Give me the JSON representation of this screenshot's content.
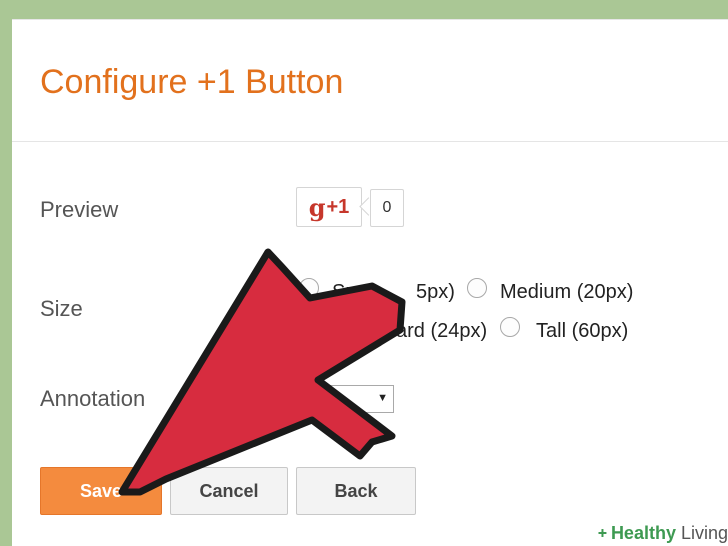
{
  "page": {
    "title": "Configure +1 Button"
  },
  "preview": {
    "label": "Preview",
    "button_g": "g",
    "button_plus": "+1",
    "count": "0"
  },
  "size": {
    "label": "Size",
    "options": [
      {
        "label": "Small (15px)",
        "visible_text": "Sm",
        "visible_text_2": "5px)",
        "selected": false
      },
      {
        "label": "Medium (20px)",
        "selected": false
      },
      {
        "label": "Standard (24px)",
        "visible_text": "ard (24px)",
        "selected": true
      },
      {
        "label": "Tall (60px)",
        "selected": false
      }
    ]
  },
  "annotation": {
    "label": "Annotation",
    "selected_visible": "ble"
  },
  "buttons": {
    "save": "Save",
    "cancel": "Cancel",
    "back": "Back"
  },
  "watermark": {
    "brand_bold": "Healthy",
    "brand_rest": " Living"
  },
  "colors": {
    "title": "#e2711d",
    "save_button": "#f48b3e",
    "arrow": "#d72c3f",
    "background": "#aac795"
  }
}
